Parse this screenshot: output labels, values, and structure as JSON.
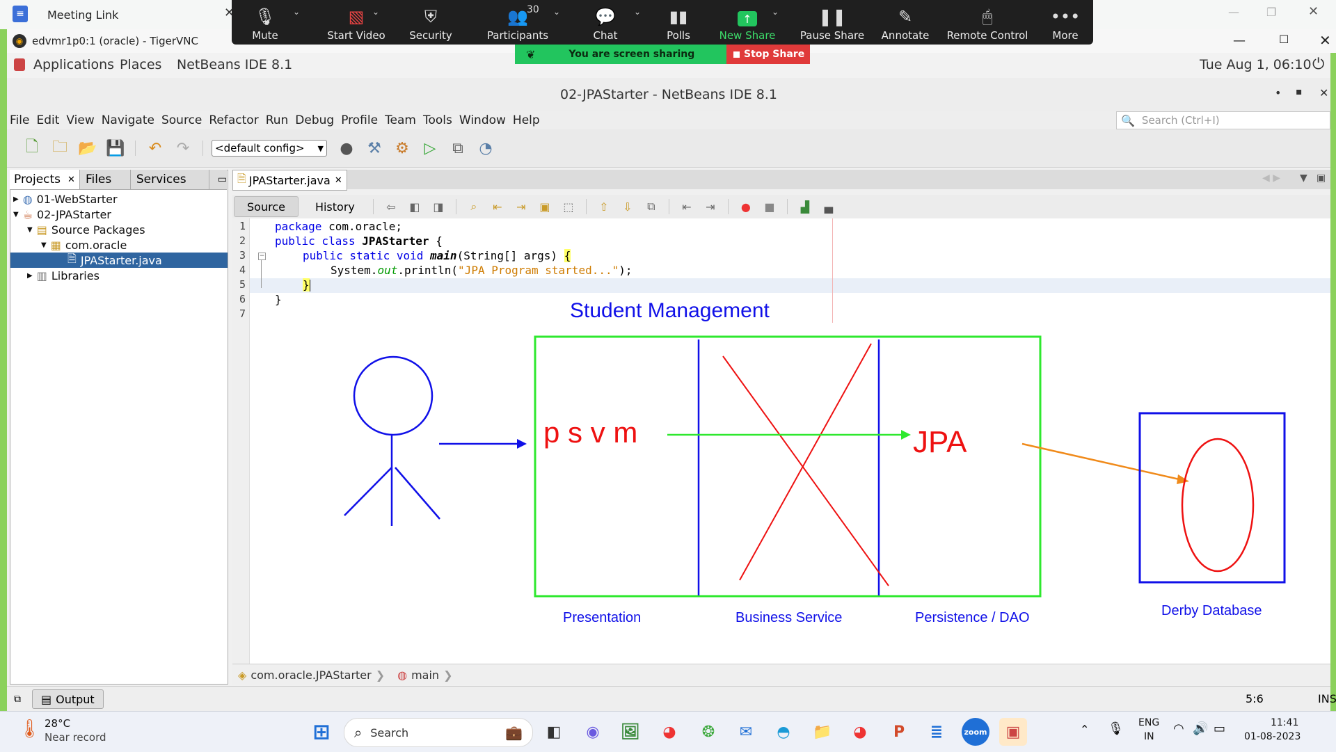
{
  "meeting": {
    "title": "Meeting Link"
  },
  "vnc": {
    "title": "edvmr1p0:1 (oracle) - TigerVNC"
  },
  "zoom": {
    "items": [
      {
        "label": "Mute",
        "icon": "microphone-icon"
      },
      {
        "label": "Start Video",
        "icon": "video-off-icon"
      },
      {
        "label": "Security",
        "icon": "shield-icon"
      },
      {
        "label": "Participants",
        "icon": "participants-icon",
        "count": "30"
      },
      {
        "label": "Chat",
        "icon": "chat-icon"
      },
      {
        "label": "Polls",
        "icon": "polls-icon"
      },
      {
        "label": "New Share",
        "icon": "new-share-icon"
      },
      {
        "label": "Pause Share",
        "icon": "pause-icon"
      },
      {
        "label": "Annotate",
        "icon": "pencil-icon"
      },
      {
        "label": "Remote Control",
        "icon": "mouse-icon"
      },
      {
        "label": "More",
        "icon": "more-icon"
      }
    ],
    "banner": "You are screen sharing",
    "stop_share": "Stop Share",
    "accent": "#22c55e",
    "stop_color": "#e03a3a"
  },
  "gnome": {
    "applications": "Applications",
    "places": "Places",
    "app_name": "NetBeans IDE 8.1",
    "clock": "Tue Aug  1, 06:10"
  },
  "netbeans": {
    "title": "02-JPAStarter - NetBeans IDE 8.1",
    "menu": [
      "File",
      "Edit",
      "View",
      "Navigate",
      "Source",
      "Refactor",
      "Run",
      "Debug",
      "Profile",
      "Team",
      "Tools",
      "Window",
      "Help"
    ],
    "search_placeholder": "Search (Ctrl+I)",
    "config": "<default config>",
    "left_tabs": [
      "Projects",
      "Files",
      "Services"
    ],
    "tree": [
      {
        "label": "01-WebStarter",
        "level": 0,
        "expanded": false,
        "icon": "globe-icon"
      },
      {
        "label": "02-JPAStarter",
        "level": 0,
        "expanded": true,
        "icon": "java-project-icon"
      },
      {
        "label": "Source Packages",
        "level": 1,
        "expanded": true,
        "icon": "source-packages-icon"
      },
      {
        "label": "com.oracle",
        "level": 2,
        "expanded": true,
        "icon": "package-icon"
      },
      {
        "label": "JPAStarter.java",
        "level": 3,
        "selected": true,
        "icon": "java-file-icon"
      },
      {
        "label": "Libraries",
        "level": 1,
        "expanded": false,
        "icon": "libraries-icon"
      }
    ],
    "editor_tab": "JPAStarter.java",
    "source_tab": "Source",
    "history_tab": "History",
    "line_numbers": [
      "1",
      "2",
      "3",
      "4",
      "5",
      "6",
      "7"
    ],
    "code": {
      "l1a": "package",
      "l1b": " com.oracle;",
      "l2a": "public class",
      "l2b": " JPAStarter",
      "l2c": " {",
      "l3a": "public static void",
      "l3b": " main",
      "l3c": "(String[] args) ",
      "l3d": "{",
      "l4a": "System.",
      "l4b": "out",
      "l4c": ".println(",
      "l4d": "\"JPA Program started...\"",
      "l4e": ");",
      "l5": "}",
      "l6": "}"
    },
    "breadcrumb": [
      "com.oracle.JPAStarter",
      "main"
    ],
    "output_tab": "Output",
    "caret_pos": "5:6",
    "ins": "INS"
  },
  "drawing": {
    "title": "Student Management",
    "psvm": "p s v m",
    "jpa": "JPA",
    "labels": [
      "Presentation",
      "Business Service",
      "Persistence / DAO",
      "Derby Database"
    ]
  },
  "taskbar": {
    "weather_temp": "28°C",
    "weather_text": "Near record",
    "search": "Search",
    "lang1": "ENG",
    "lang2": "IN",
    "time": "11:41",
    "date": "01-08-2023"
  }
}
